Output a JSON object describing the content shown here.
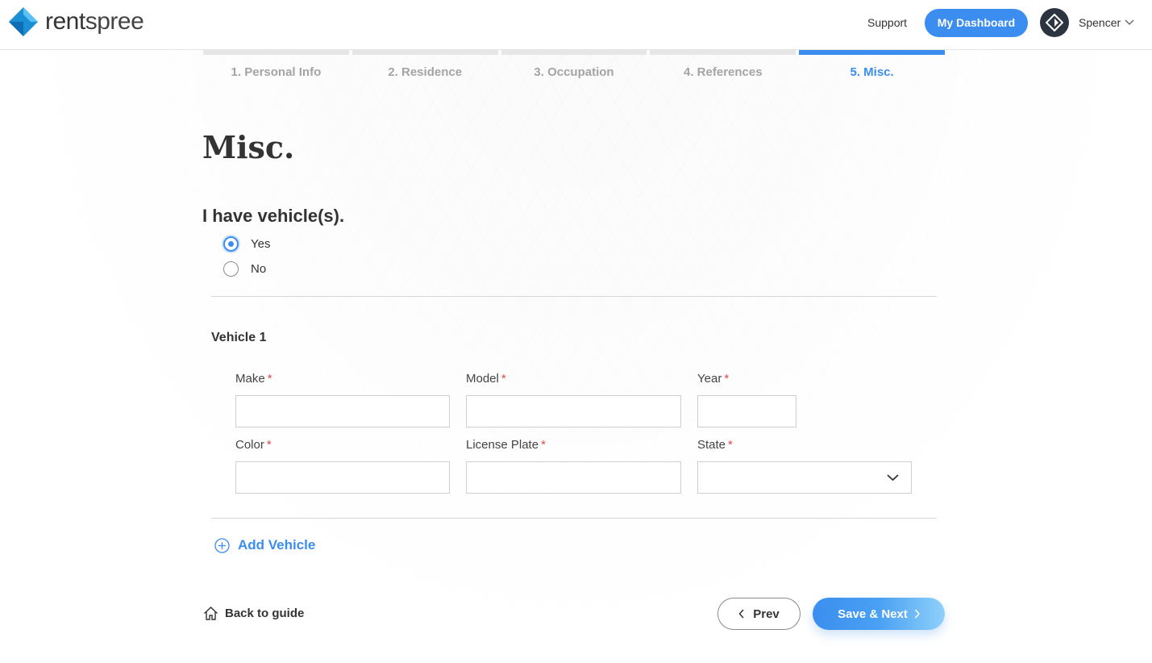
{
  "header": {
    "logo_text_bold": "rent",
    "logo_text": "spree",
    "support_label": "Support",
    "dashboard_label": "My Dashboard",
    "username": "Spencer"
  },
  "steps": [
    {
      "label": "1. Personal Info",
      "active": false
    },
    {
      "label": "2. Residence",
      "active": false
    },
    {
      "label": "3. Occupation",
      "active": false
    },
    {
      "label": "4. References",
      "active": false
    },
    {
      "label": "5. Misc.",
      "active": true
    }
  ],
  "page": {
    "title": "Misc.",
    "question": "I have vehicle(s).",
    "options": [
      {
        "label": "Yes",
        "checked": true
      },
      {
        "label": "No",
        "checked": false
      }
    ]
  },
  "vehicle": {
    "title": "Vehicle 1",
    "required_mark": "*",
    "fields": {
      "make": {
        "label": "Make",
        "value": ""
      },
      "model": {
        "label": "Model",
        "value": ""
      },
      "year": {
        "label": "Year",
        "value": ""
      },
      "color": {
        "label": "Color",
        "value": ""
      },
      "license_plate": {
        "label": "License Plate",
        "value": ""
      },
      "state": {
        "label": "State",
        "value": ""
      }
    },
    "add_label": "Add Vehicle"
  },
  "footer": {
    "back_label": "Back to guide",
    "prev_label": "Prev",
    "next_label": "Save & Next"
  },
  "colors": {
    "accent": "#3b8eef",
    "required": "#e04b4b",
    "logo_blue": "#1a8fd6"
  }
}
